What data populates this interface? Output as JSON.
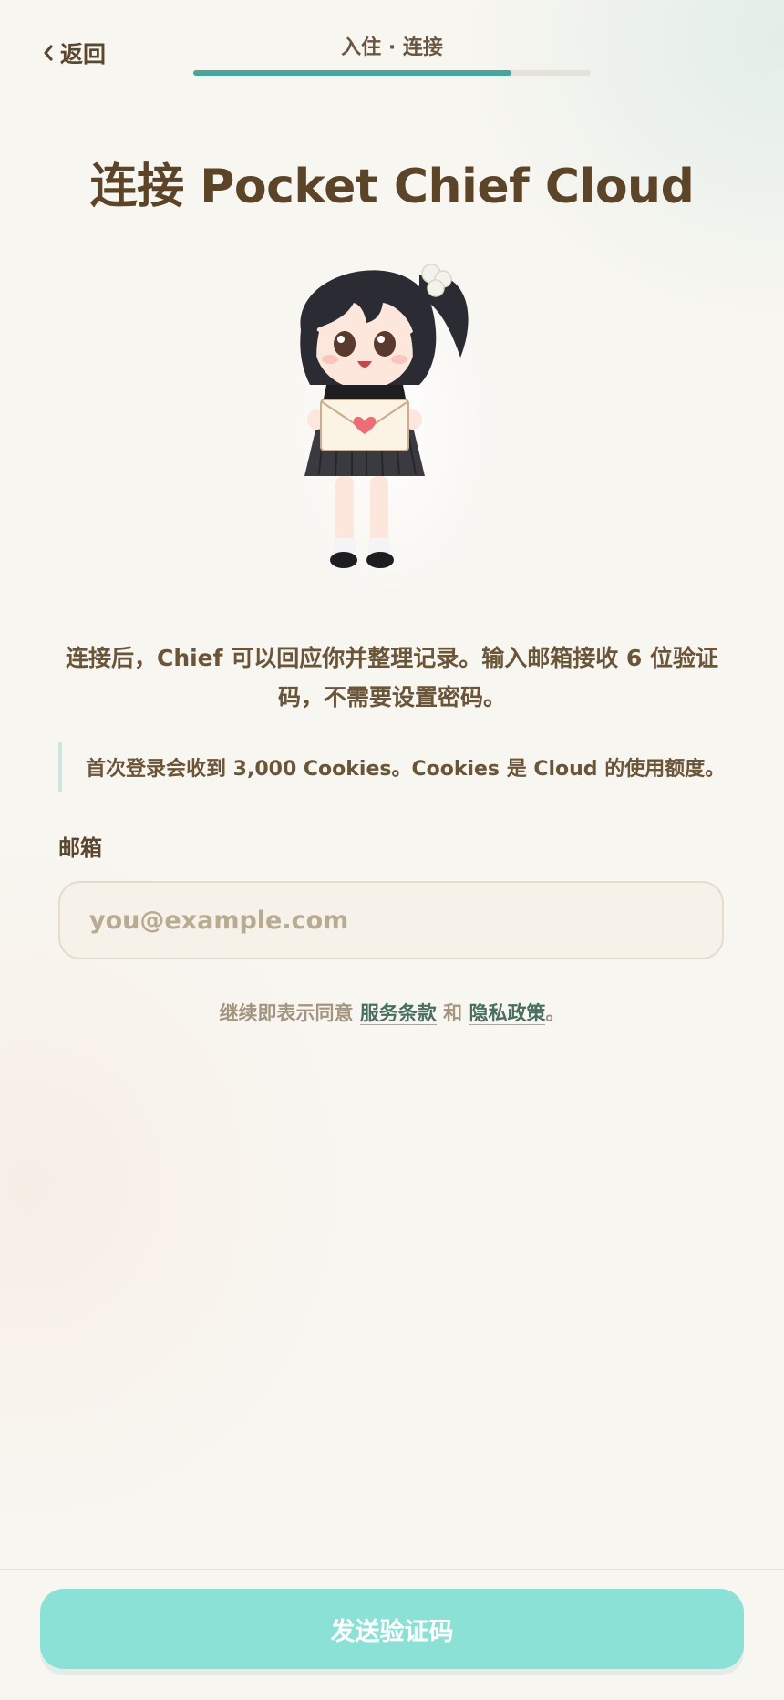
{
  "header": {
    "back_label": "返回",
    "step_label": "入住 · 连接",
    "progress": 0.8
  },
  "title": "连接 Pocket Chief Cloud",
  "mascot": {
    "icon": "chibi-girl-holding-letter"
  },
  "description": "连接后，Chief 可以回应你并整理记录。输入邮箱接收 6 位验证码，不需要设置密码。",
  "note": "首次登录会收到 3,000 Cookies。Cookies 是 Cloud 的使用额度。",
  "email": {
    "label": "邮箱",
    "placeholder": "you@example.com",
    "value": ""
  },
  "terms": {
    "prefix": "继续即表示同意",
    "terms_link": "服务条款",
    "and": "和",
    "privacy_link": "隐私政策",
    "suffix": "。"
  },
  "send_button": "发送验证码",
  "colors": {
    "accent": "#4aa69a",
    "button": "#8ce1d6",
    "text": "#5b4630",
    "link": "#4a6f61"
  }
}
